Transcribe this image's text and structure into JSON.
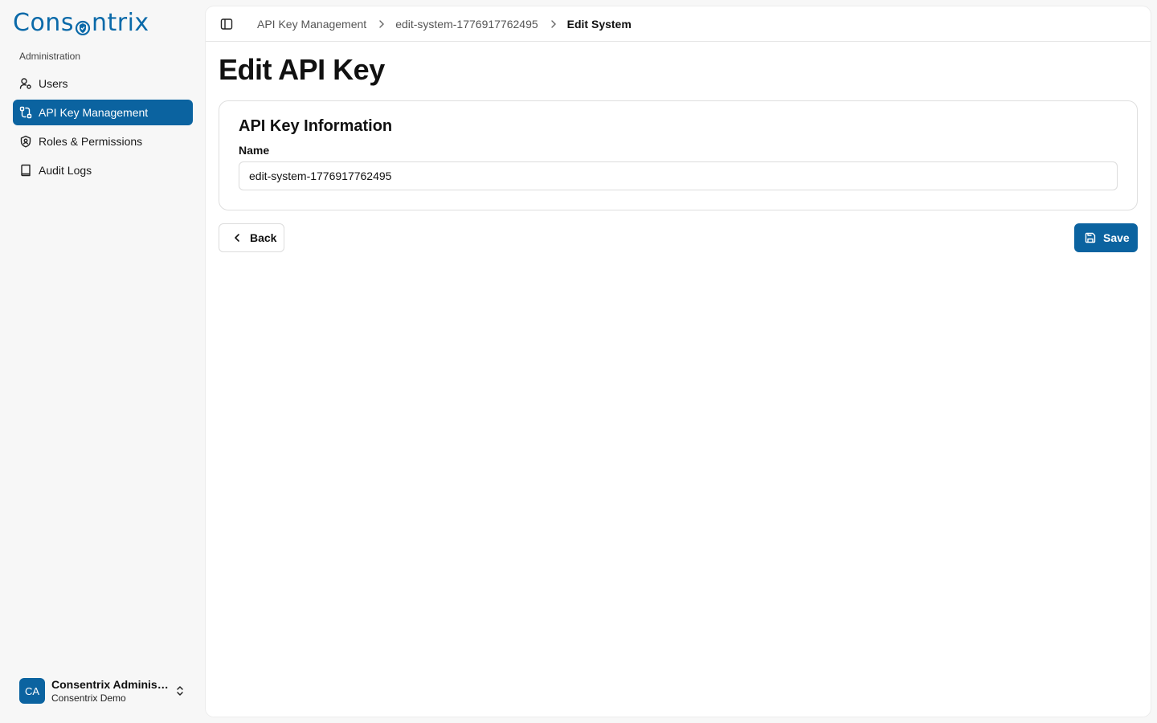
{
  "brand": {
    "logo_text_left": "Cons",
    "logo_text_right": "ntrix",
    "color": "#0b6aa9"
  },
  "sidebar": {
    "section_label": "Administration",
    "items": [
      {
        "label": "Users",
        "icon": "user-cog-icon",
        "active": false
      },
      {
        "label": "API Key Management",
        "icon": "key-route-icon",
        "active": true
      },
      {
        "label": "Roles & Permissions",
        "icon": "shield-icon",
        "active": false
      },
      {
        "label": "Audit Logs",
        "icon": "book-icon",
        "active": false
      }
    ],
    "user": {
      "initials": "CA",
      "name": "Consentrix Administrator",
      "org": "Consentrix Demo"
    }
  },
  "breadcrumb": {
    "items": [
      "API Key Management",
      "edit-system-1776917762495",
      "Edit System"
    ]
  },
  "page": {
    "title": "Edit API Key",
    "card_title": "API Key Information",
    "name_label": "Name",
    "name_value": "edit-system-1776917762495"
  },
  "actions": {
    "back_label": "Back",
    "save_label": "Save"
  },
  "colors": {
    "accent": "#0b63a0",
    "background": "#f7f7f7"
  }
}
